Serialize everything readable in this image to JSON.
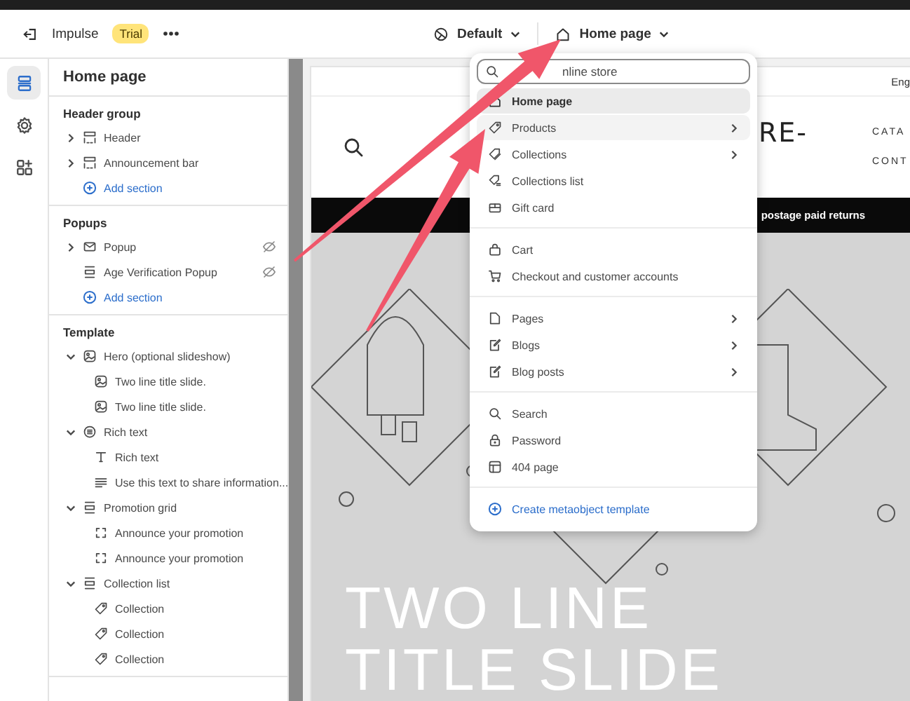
{
  "topbar": {
    "theme_name": "Impulse",
    "badge": "Trial",
    "theme_selector": "Default",
    "page_selector": "Home page"
  },
  "rail": [
    {
      "kind": "sections",
      "selected": true
    },
    {
      "kind": "settings",
      "selected": false
    },
    {
      "kind": "apps",
      "selected": false
    }
  ],
  "sidebar": {
    "title": "Home page",
    "groups": [
      {
        "title": "Header group",
        "add_label": "Add section",
        "items": [
          {
            "label": "Header",
            "kind": "header",
            "expanded": false,
            "hidden": false
          },
          {
            "label": "Announcement bar",
            "kind": "header",
            "expanded": false,
            "hidden": false
          }
        ]
      },
      {
        "title": "Popups",
        "add_label": "Add section",
        "items": [
          {
            "label": "Popup",
            "kind": "mail",
            "expanded": false,
            "hidden": true
          },
          {
            "label": "Age Verification Popup",
            "kind": "section",
            "hidden": true
          }
        ]
      },
      {
        "title": "Template",
        "items": [
          {
            "label": "Hero (optional slideshow)",
            "kind": "image",
            "expanded": true,
            "hidden": false,
            "children": [
              {
                "label": "Two line title slide.",
                "kind": "image"
              },
              {
                "label": "Two line title slide.",
                "kind": "image"
              }
            ]
          },
          {
            "label": "Rich text",
            "kind": "text",
            "expanded": true,
            "hidden": false,
            "children": [
              {
                "label": "Rich text",
                "kind": "heading"
              },
              {
                "label": "Use this text to share information...",
                "kind": "paragraph"
              }
            ]
          },
          {
            "label": "Promotion grid",
            "kind": "section",
            "expanded": true,
            "hidden": false,
            "children": [
              {
                "label": "Announce your promotion",
                "kind": "block"
              },
              {
                "label": "Announce your promotion",
                "kind": "block"
              }
            ]
          },
          {
            "label": "Collection list",
            "kind": "section",
            "expanded": true,
            "hidden": false,
            "children": [
              {
                "label": "Collection",
                "kind": "collection"
              },
              {
                "label": "Collection",
                "kind": "collection"
              },
              {
                "label": "Collection",
                "kind": "collection"
              }
            ]
          }
        ]
      }
    ]
  },
  "preview": {
    "language": "Eng",
    "logo_lines": [
      "RE-"
    ],
    "nav": [
      "CATA",
      "CONT"
    ],
    "announcement": "postage paid returns",
    "hero_title": [
      "TWO LINE",
      "TITLE SLIDE"
    ]
  },
  "menu": {
    "search": {
      "placeholder": "nline store"
    },
    "sections": [
      [
        {
          "label": "Home page",
          "kind": "home",
          "selected": true,
          "hovered": false,
          "submenu": false
        },
        {
          "label": "Products",
          "kind": "product",
          "selected": false,
          "hovered": true,
          "submenu": true
        },
        {
          "label": "Collections",
          "kind": "collections",
          "selected": false,
          "hovered": false,
          "submenu": true
        },
        {
          "label": "Collections list",
          "kind": "collections-list",
          "selected": false,
          "hovered": false,
          "submenu": false
        },
        {
          "label": "Gift card",
          "kind": "gift",
          "selected": false,
          "hovered": false,
          "submenu": false
        }
      ],
      [
        {
          "label": "Cart",
          "kind": "cart",
          "selected": false,
          "hovered": false,
          "submenu": false
        },
        {
          "label": "Checkout and customer accounts",
          "kind": "checkout",
          "selected": false,
          "hovered": false,
          "submenu": false
        }
      ],
      [
        {
          "label": "Pages",
          "kind": "page",
          "selected": false,
          "hovered": false,
          "submenu": true
        },
        {
          "label": "Blogs",
          "kind": "blog",
          "selected": false,
          "hovered": false,
          "submenu": true
        },
        {
          "label": "Blog posts",
          "kind": "blog",
          "selected": false,
          "hovered": false,
          "submenu": true
        }
      ],
      [
        {
          "label": "Search",
          "kind": "search",
          "selected": false,
          "hovered": false,
          "submenu": false
        },
        {
          "label": "Password",
          "kind": "password",
          "selected": false,
          "hovered": false,
          "submenu": false
        },
        {
          "label": "404 page",
          "kind": "notfound",
          "selected": false,
          "hovered": false,
          "submenu": false
        }
      ]
    ],
    "create_label": "Create metaobject template"
  }
}
